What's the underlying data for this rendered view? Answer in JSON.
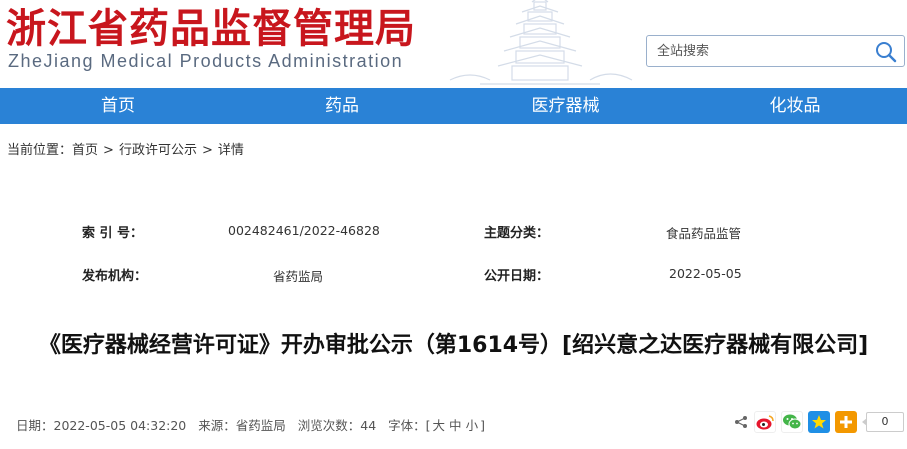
{
  "header": {
    "site_title": "浙江省药品监督管理局",
    "site_subtitle": "ZheJiang Medical Products Administration",
    "search_placeholder": "全站搜索"
  },
  "nav": {
    "items": [
      {
        "label": "首页"
      },
      {
        "label": "药品"
      },
      {
        "label": "医疗器械"
      },
      {
        "label": "化妆品"
      }
    ]
  },
  "breadcrumb": {
    "prefix": "当前位置：",
    "items": [
      {
        "label": "首页"
      },
      {
        "label": "行政许可公示"
      },
      {
        "label": "详情"
      }
    ],
    "separator": ">"
  },
  "meta": {
    "index_label": "索 引 号：",
    "index_value": "002482461/2022-46828",
    "topic_label": "主题分类：",
    "topic_value": "食品药品监管",
    "publisher_label": "发布机构：",
    "publisher_value": "省药监局",
    "date_label": "公开日期：",
    "date_value": "2022-05-05"
  },
  "article": {
    "title": "《医疗器械经营许可证》开办审批公示（第1614号）[绍兴意之达医疗器械有限公司]",
    "date_text": "日期：2022-05-05 04:32:20",
    "source_text": "来源：省药监局",
    "views_text": "浏览次数：44",
    "font_label": "字体：[",
    "font_large": "大",
    "font_medium": "中",
    "font_small": "小",
    "font_close": "]"
  },
  "share": {
    "count": "0"
  },
  "colors": {
    "brand_red": "#c8161d",
    "nav_blue": "#2a82d6"
  }
}
